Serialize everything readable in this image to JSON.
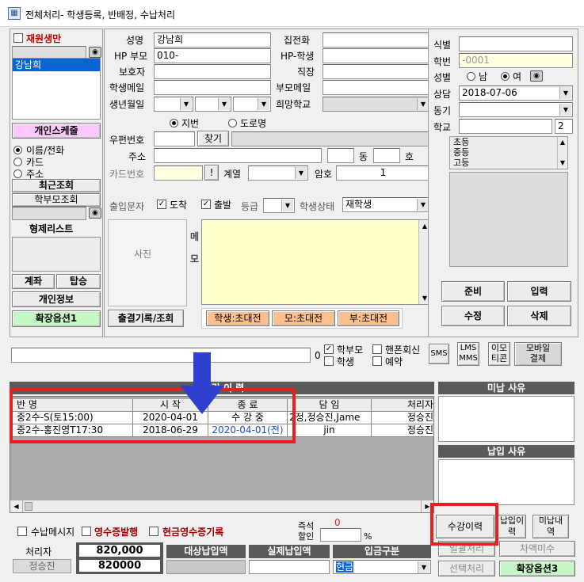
{
  "window": {
    "title": "전체처리- 학생등록, 반배정, 수납처리"
  },
  "left_panel": {
    "reregister_label": "재원생만",
    "student_list": [
      "강남희"
    ],
    "schedule_button": "개인스케줄",
    "search_modes": [
      "이름/전화",
      "카드",
      "주소"
    ],
    "recent_lookup": "최근조회",
    "parent_lookup": "학부모조회",
    "sibling_list": "형제리스트",
    "account_button": "계좌",
    "withdraw_button": "탑승",
    "personal_info_button": "개인정보",
    "ext_option1": "확장옵션1"
  },
  "form": {
    "name_label": "성명",
    "name_value": "강남희",
    "hp_parent_label": "HP 부모",
    "hp_parent_value": "010-",
    "guardian_label": "보호자",
    "student_email_label": "학생메일",
    "birth_label": "생년월일",
    "home_phone_label": "집전화",
    "hp_student_label": "HP-학생",
    "job_label": "직장",
    "parent_email_label": "부모메일",
    "desired_school_label": "희망학교",
    "addr_type_options": [
      "지번",
      "도로명"
    ],
    "zip_label": "우편번호",
    "find_button": "찾기",
    "address_label": "주소",
    "dong_label": "동",
    "ho_label": "호",
    "card_label": "카드번호",
    "card_button": "!",
    "track_label": "계열",
    "password_label": "암호",
    "password_value": "1",
    "sms_label": "출입문자",
    "arrive_label": "도착",
    "depart_label": "출발",
    "grade_label": "등급",
    "status_label": "학생상태",
    "status_value": "재학생",
    "photo_label": "사진",
    "memo_label_1": "메",
    "memo_label_2": "모",
    "attendance_button": "출결기록/조회",
    "invite_student": "학생:초대전",
    "invite_mother": "모:초대전",
    "invite_father": "부:초대전"
  },
  "right_panel": {
    "id_label": "식별",
    "student_no_label": "학번",
    "student_no_value": "-0001",
    "gender_label": "성별",
    "male": "남",
    "female": "여",
    "consult_label": "상담",
    "consult_value": "2018-07-06",
    "motive_label": "동기",
    "school_label": "학교",
    "school_grade_value": "2",
    "school_levels": [
      "초등",
      "중등",
      "고등"
    ],
    "prep_button": "준비",
    "input_button": "입력",
    "edit_button": "수정",
    "delete_button": "삭제"
  },
  "message_bar": {
    "count": "0",
    "parent_opt": "학부모",
    "student_opt": "학생",
    "phone_reply_opt": "핸폰회신",
    "reserve_opt": "예약",
    "sms_button": "SMS",
    "lms_button_1": "LMS",
    "lms_button_2": "MMS",
    "emoticon_button_1": "이모",
    "emoticon_button_2": "티콘",
    "mobile_pay_button_1": "모바일",
    "mobile_pay_button_2": "결제"
  },
  "enrollment": {
    "section_title": "수 강 이 력",
    "columns": [
      "반 명",
      "시 작",
      "종 료",
      "담 임",
      "처리자"
    ],
    "rows": [
      {
        "class": "중2수-S(토15:00)",
        "start": "2020-04-01",
        "end": "수 강 중",
        "teacher": "2정,정승진,Jame",
        "handler": "정승진"
      },
      {
        "class": "중2수-홍진영T17:30",
        "start": "2018-06-29",
        "end": "2020-04-01(전)",
        "teacher": "jin",
        "handler": "정승진"
      }
    ]
  },
  "side_reasons": {
    "unpaid_reason": "미납 사유",
    "paid_reason": "납입 사유"
  },
  "bottom": {
    "payment_msg_label": "수납메시지",
    "receipt_label": "영수증발행",
    "cash_receipt_label": "현금영수증기록",
    "discount_label_1": "즉석",
    "discount_label_2": "할인",
    "discount_value": "0",
    "percent": "%",
    "handler_label": "처리자",
    "handler_value": "정승진",
    "amount_1": "820,000",
    "amount_2": "820000",
    "target_amount_label": "대상납입액",
    "actual_amount_label": "실제납입액",
    "payment_type_label": "입금구분",
    "payment_type_value": "현금",
    "history_button": "수강이력",
    "paid_history_button_1": "납입이",
    "paid_history_button_2": "력",
    "unpaid_history_button_1": "미납내",
    "unpaid_history_button_2": "역",
    "bulk_button": "일괄처리",
    "diff_button": "차액미수",
    "select_button": "선택처리",
    "ext_option3": "확장옵션3"
  },
  "colors": {
    "annotation_red": "#e62020",
    "arrow_blue": "#2f3fd0",
    "highlight_blue": "#1c4fc9"
  }
}
